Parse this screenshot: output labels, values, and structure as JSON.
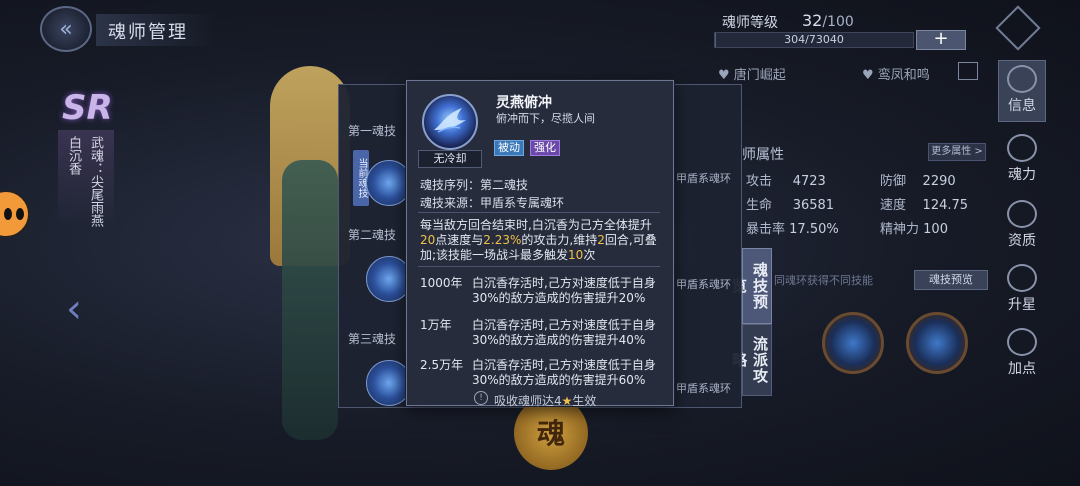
{
  "header": {
    "title": "魂师管理"
  },
  "level": {
    "label": "魂师等级",
    "current": "32",
    "max": "/100",
    "exp_text": "304/73040",
    "exp_fraction": 0.004,
    "plus_label": "+"
  },
  "clans": {
    "left": "唐门崛起",
    "right": "鸾凤和鸣"
  },
  "right_nav": [
    {
      "label": "信息",
      "icon": "info-icon"
    },
    {
      "label": "魂力",
      "icon": "soul-power-icon"
    },
    {
      "label": "资质",
      "icon": "aptitude-icon"
    },
    {
      "label": "升星",
      "icon": "star-up-icon"
    },
    {
      "label": "加点",
      "icon": "add-point-icon"
    }
  ],
  "attributes": {
    "title": "师属性",
    "more_label": "更多属性 >",
    "items": [
      {
        "label": "攻击",
        "value": "4723"
      },
      {
        "label": "防御",
        "value": "2290"
      },
      {
        "label": "生命",
        "value": "36581"
      },
      {
        "label": "速度",
        "value": "124.75"
      },
      {
        "label": "暴击率",
        "value": "17.50%"
      },
      {
        "label": "精神力",
        "value": "100"
      }
    ]
  },
  "tabs": {
    "preview": "魂技预览",
    "strategy": "流派攻略"
  },
  "skill_hint": "同魂环获得不同技能",
  "preview_button": "魂技预览",
  "character": {
    "rarity": "SR",
    "name": "白沉香",
    "title": "武魂：尖尾雨燕"
  },
  "skill_panel": {
    "slots": [
      "第一魂技",
      "第二魂技",
      "第三魂技"
    ],
    "current_tag": "当前魂技",
    "ring_text": "甲盾系魂环"
  },
  "emblem_text": "魂",
  "tooltip": {
    "cooldown": "无冷却",
    "name": "灵燕俯冲",
    "desc": "俯冲而下，尽揽人间",
    "tag_passive": "被动",
    "tag_enhance": "强化",
    "order_line": "魂技序列：第二魂技",
    "source_line": "魂技来源：甲盾系专属魂环",
    "main_p1": "每当敌方回合结束时,白沉香为己方全体提升",
    "main_n1": "20",
    "main_p2": "点速度与",
    "main_n2": "2.23%",
    "main_p3": "的攻击力,维持",
    "main_n3": "2",
    "main_p4": "回合,可叠加;该技能一场战斗最多触发",
    "main_n4": "10",
    "main_p5": "次",
    "tiers": [
      {
        "year": "1000年",
        "text": "白沉香存活时,己方对速度低于自身30%的敌方造成的伤害提升20%"
      },
      {
        "year": "1万年",
        "text": "白沉香存活时,己方对速度低于自身30%的敌方造成的伤害提升40%"
      },
      {
        "year": "2.5万年",
        "text": "白沉香存活时,己方对速度低于自身30%的敌方造成的伤害提升60%"
      }
    ],
    "footer_pre": "吸收魂师达4",
    "footer_post": "生效"
  }
}
